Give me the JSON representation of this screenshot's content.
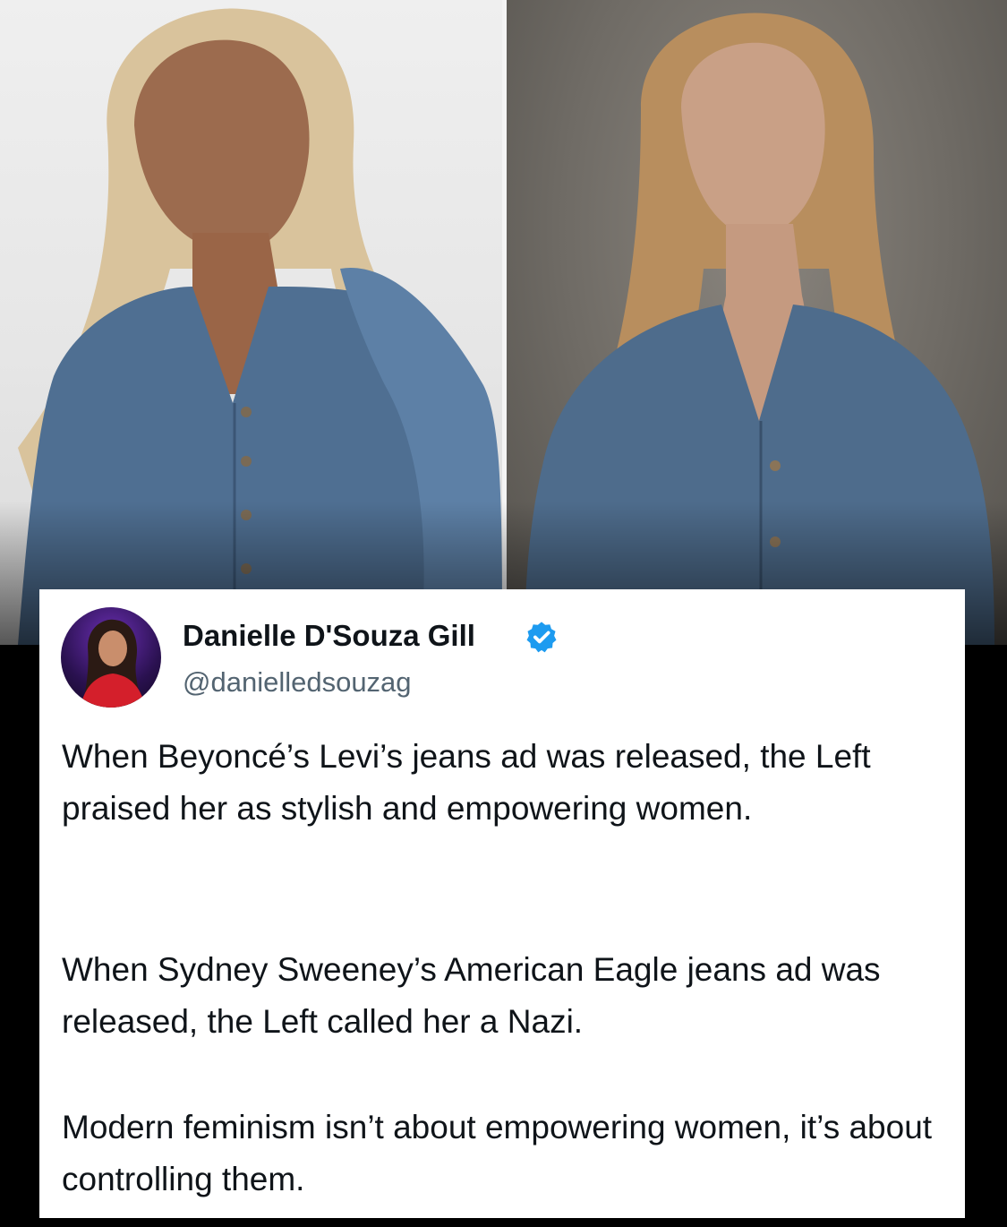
{
  "photos": {
    "left": {
      "icon": "portrait-woman-blonde-denim-photo"
    },
    "right": {
      "icon": "portrait-woman-blonde-denim-jacket-photo"
    }
  },
  "tweet": {
    "author": {
      "name": "Danielle D'Souza Gill",
      "handle": "@danielledsouzag",
      "verified": true,
      "avatar_icon": "profile-photo-avatar"
    },
    "paragraphs": [
      "When Beyoncé’s Levi’s jeans ad was released, the Left praised her as stylish and empowering women.",
      "When Sydney Sweeney’s American Eagle jeans ad was released, the Left called her a Nazi.",
      "Modern feminism isn’t about empowering women, it’s about controlling them."
    ]
  },
  "colors": {
    "verified_badge": "#1d9bf0",
    "text_primary": "#0f1419",
    "text_secondary": "#536471",
    "card_background": "#ffffff",
    "page_background": "#000000"
  }
}
